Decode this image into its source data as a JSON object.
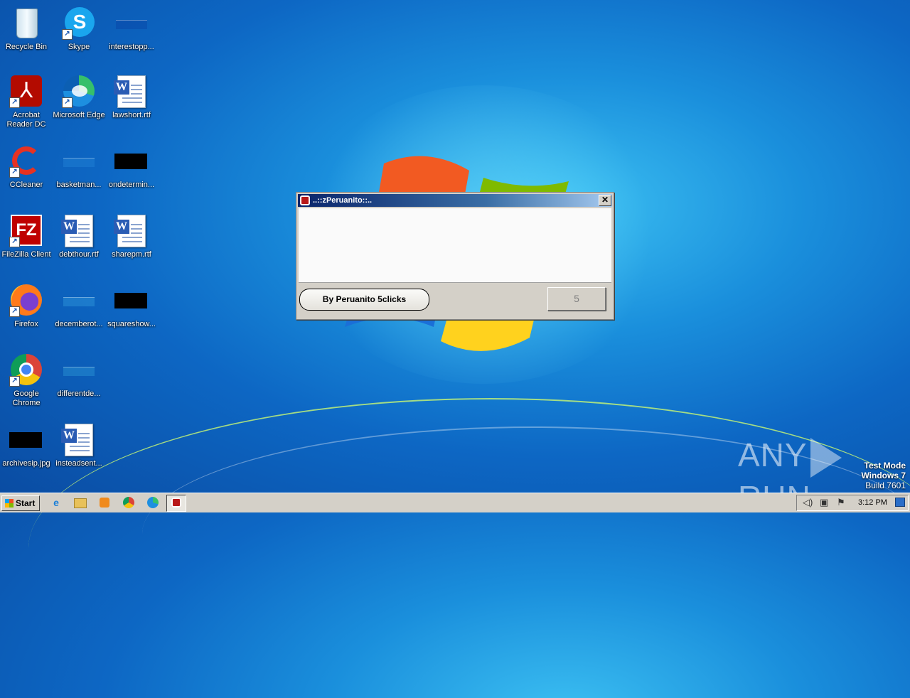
{
  "desktop": {
    "icons": [
      {
        "label": "Recycle Bin"
      },
      {
        "label": "Skype"
      },
      {
        "label": "interestopp..."
      },
      {
        "label": "Acrobat Reader DC"
      },
      {
        "label": "Microsoft Edge"
      },
      {
        "label": "lawshort.rtf"
      },
      {
        "label": "CCleaner"
      },
      {
        "label": "basketman..."
      },
      {
        "label": "ondetermin..."
      },
      {
        "label": "FileZilla Client"
      },
      {
        "label": "debthour.rtf"
      },
      {
        "label": "sharepm.rtf"
      },
      {
        "label": "Firefox"
      },
      {
        "label": "decemberot..."
      },
      {
        "label": "squareshow..."
      },
      {
        "label": "Google Chrome"
      },
      {
        "label": "differentde..."
      },
      {
        "label": "archivesip.jpg"
      },
      {
        "label": "insteadsent..."
      }
    ]
  },
  "dialog": {
    "title": "..::zPeruanito::..",
    "close_glyph": "✕",
    "credit_button": "By Peruanito 5clicks",
    "counter_button": "5"
  },
  "watermark": {
    "left": "ANY",
    "right": "RUN",
    "mode": "Test Mode",
    "os": "Windows 7",
    "build": "Build 7601"
  },
  "taskbar": {
    "start_label": "Start",
    "clock": "3:12 PM"
  }
}
